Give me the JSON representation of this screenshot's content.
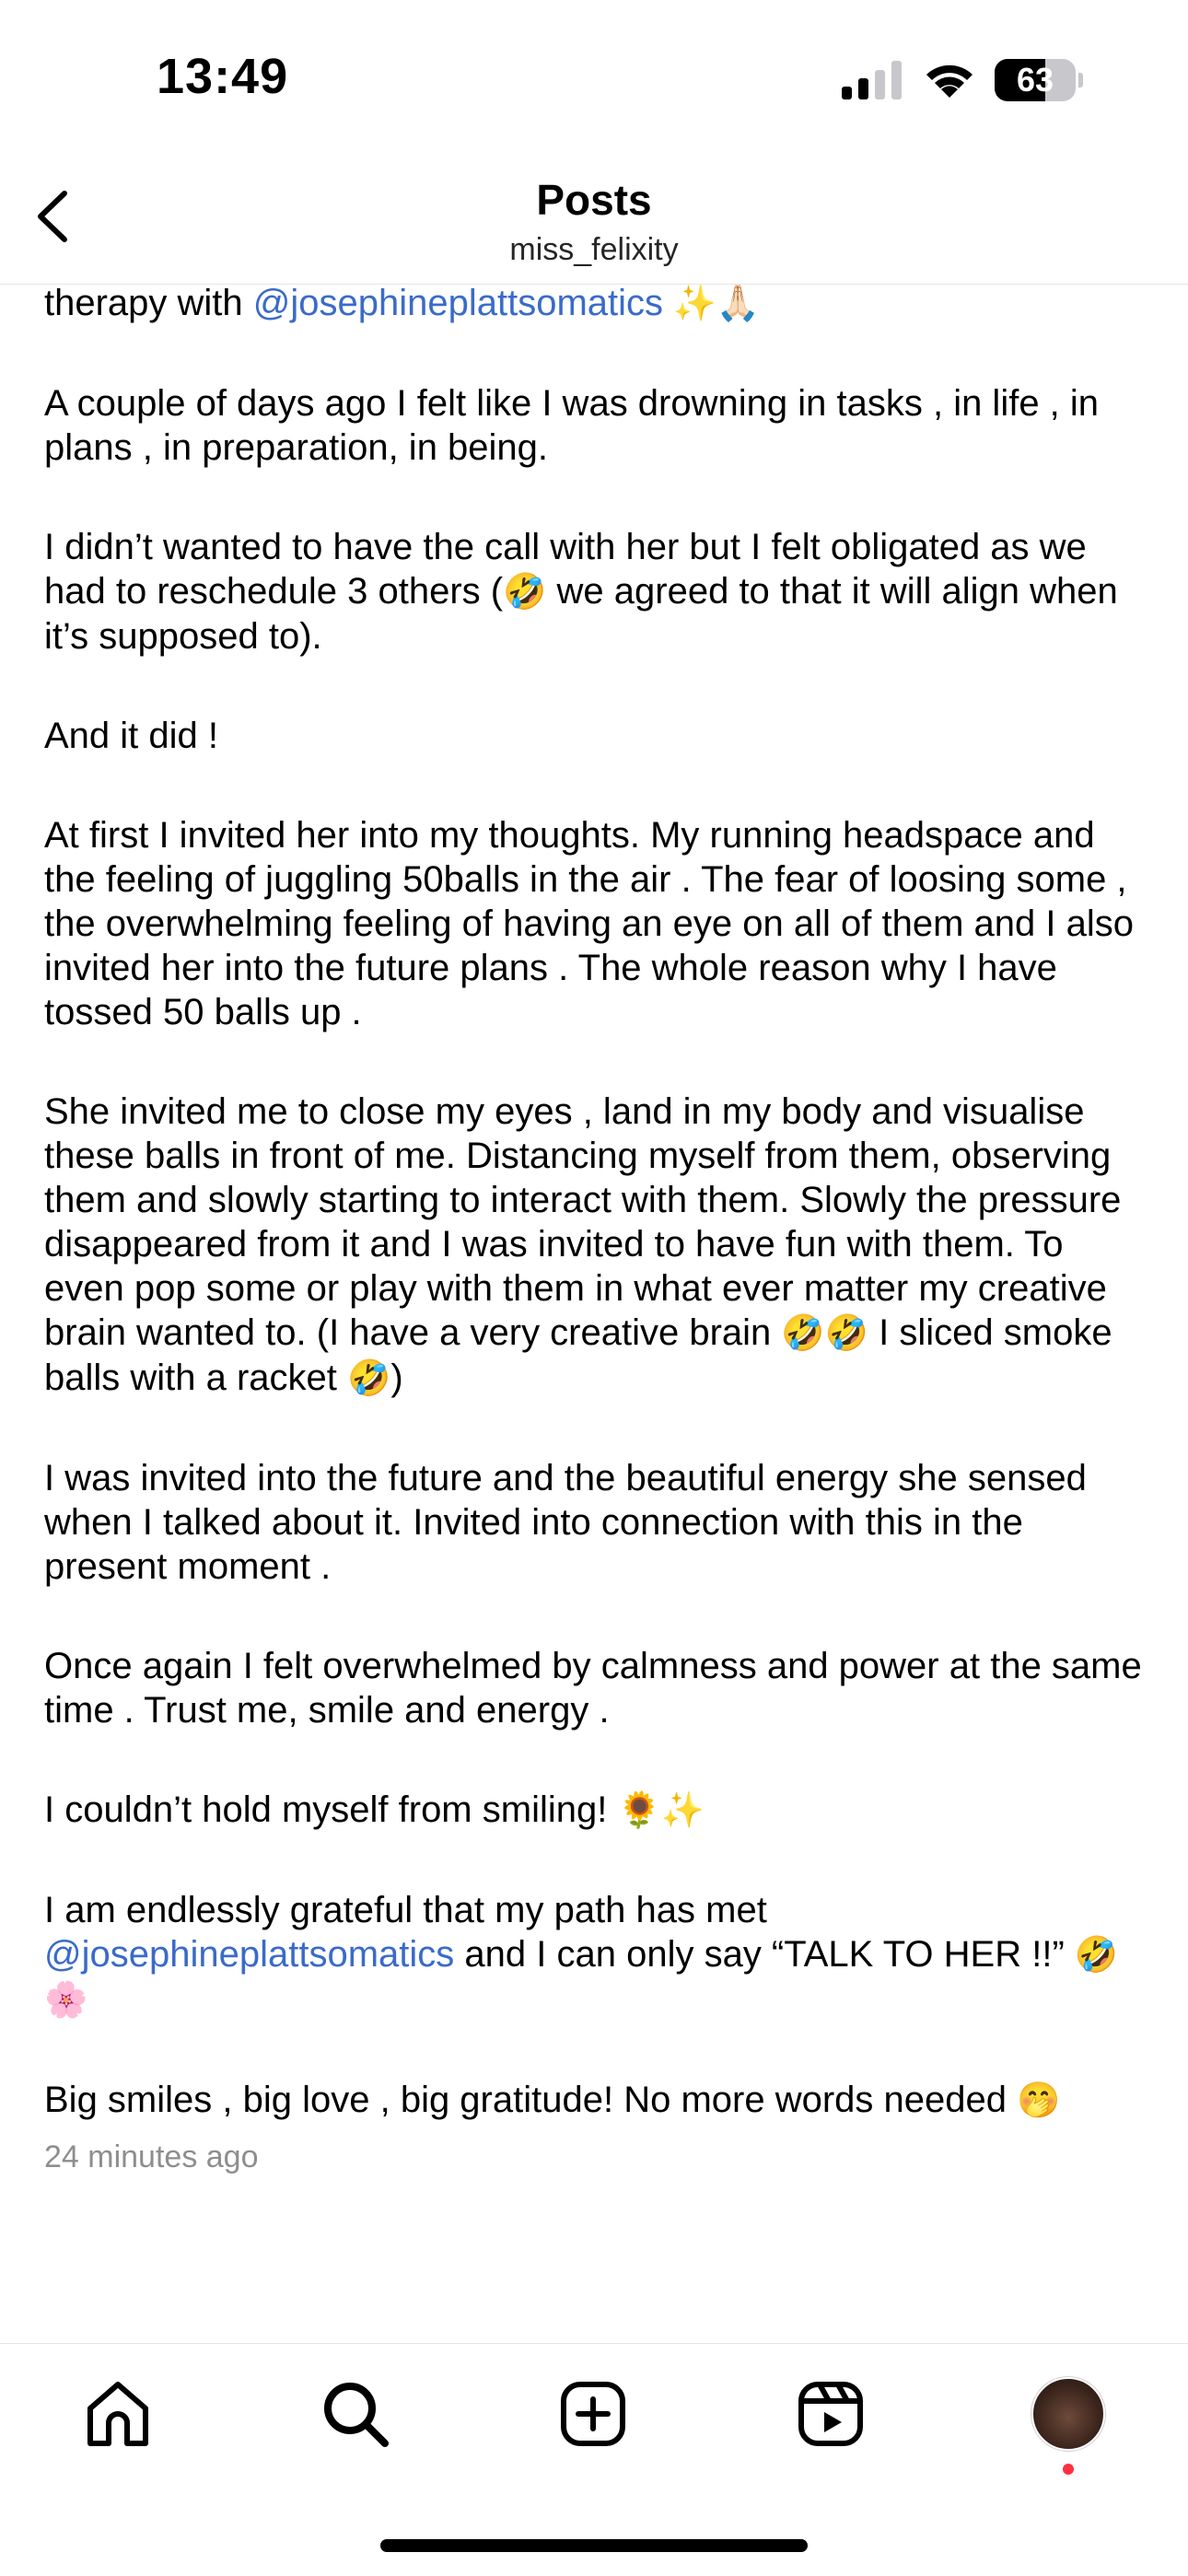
{
  "status_bar": {
    "time": "13:49",
    "battery_level": "63",
    "battery_fraction": 0.63,
    "icons": [
      "signal-icon",
      "wifi-icon",
      "battery-icon"
    ]
  },
  "header": {
    "title": "Posts",
    "username": "miss_felixity",
    "back_icon": "chevron-left-icon"
  },
  "caption": {
    "line0": {
      "text": "therapy with ",
      "mention": "@josephineplattsomatics",
      "emoji": " ✨🙏🏻"
    },
    "p1": "A couple of days ago I felt like I was drowning in tasks , in life , in plans , in preparation, in being.",
    "p2a": "I didn’t wanted to have the call with her but I felt obligated as we had to reschedule 3 others (",
    "p2_emoji": "🤣",
    "p2b": " we agreed to that it will align when it’s supposed to).",
    "p3": "And it did !",
    "p4": "At first I invited her into my thoughts. My running headspace and the feeling of juggling 50balls in the air . The fear of loosing some , the overwhelming feeling of having an eye on all of them and I also invited her into the future plans . The whole reason why I have tossed 50 balls up .",
    "p5a": "She invited me to close my eyes , land in my body and visualise these balls in front of me. Distancing myself from them, observing them and slowly starting to interact with them. Slowly the pressure disappeared from it and I was invited to have fun with them. To even pop some or play with them in what ever matter my creative brain wanted to. (I have a very creative brain ",
    "p5_emoji1": "🤣🤣",
    "p5b": " I sliced smoke balls with a racket ",
    "p5_emoji2": "🤣",
    "p5c": ")",
    "p6": "I was invited into the future and the beautiful energy she sensed when I talked about it. Invited into connection with this in the present moment .",
    "p7": "Once again I felt overwhelmed by calmness and power at the same time . Trust me, smile and energy .",
    "p8a": "I couldn’t hold myself from smiling! ",
    "p8_emoji": "🌻✨",
    "p9a": "I am endlessly grateful that my path has met ",
    "p9_mention": "@josephineplattsomatics",
    "p9b": " and I can only say “TALK TO HER !!” ",
    "p9_emoji": "🤣🌸",
    "p10a": "Big smiles , big love , big gratitude! No more words needed ",
    "p10_emoji": "🤭",
    "timestamp": "24 minutes ago"
  },
  "bottom_nav": {
    "items": [
      "home-icon",
      "search-icon",
      "create-icon",
      "reels-icon",
      "profile-avatar"
    ],
    "notification_dot_color": "#ff3040"
  },
  "colors": {
    "mention": "#3a6bc9",
    "timestamp": "#8e8e8e"
  }
}
